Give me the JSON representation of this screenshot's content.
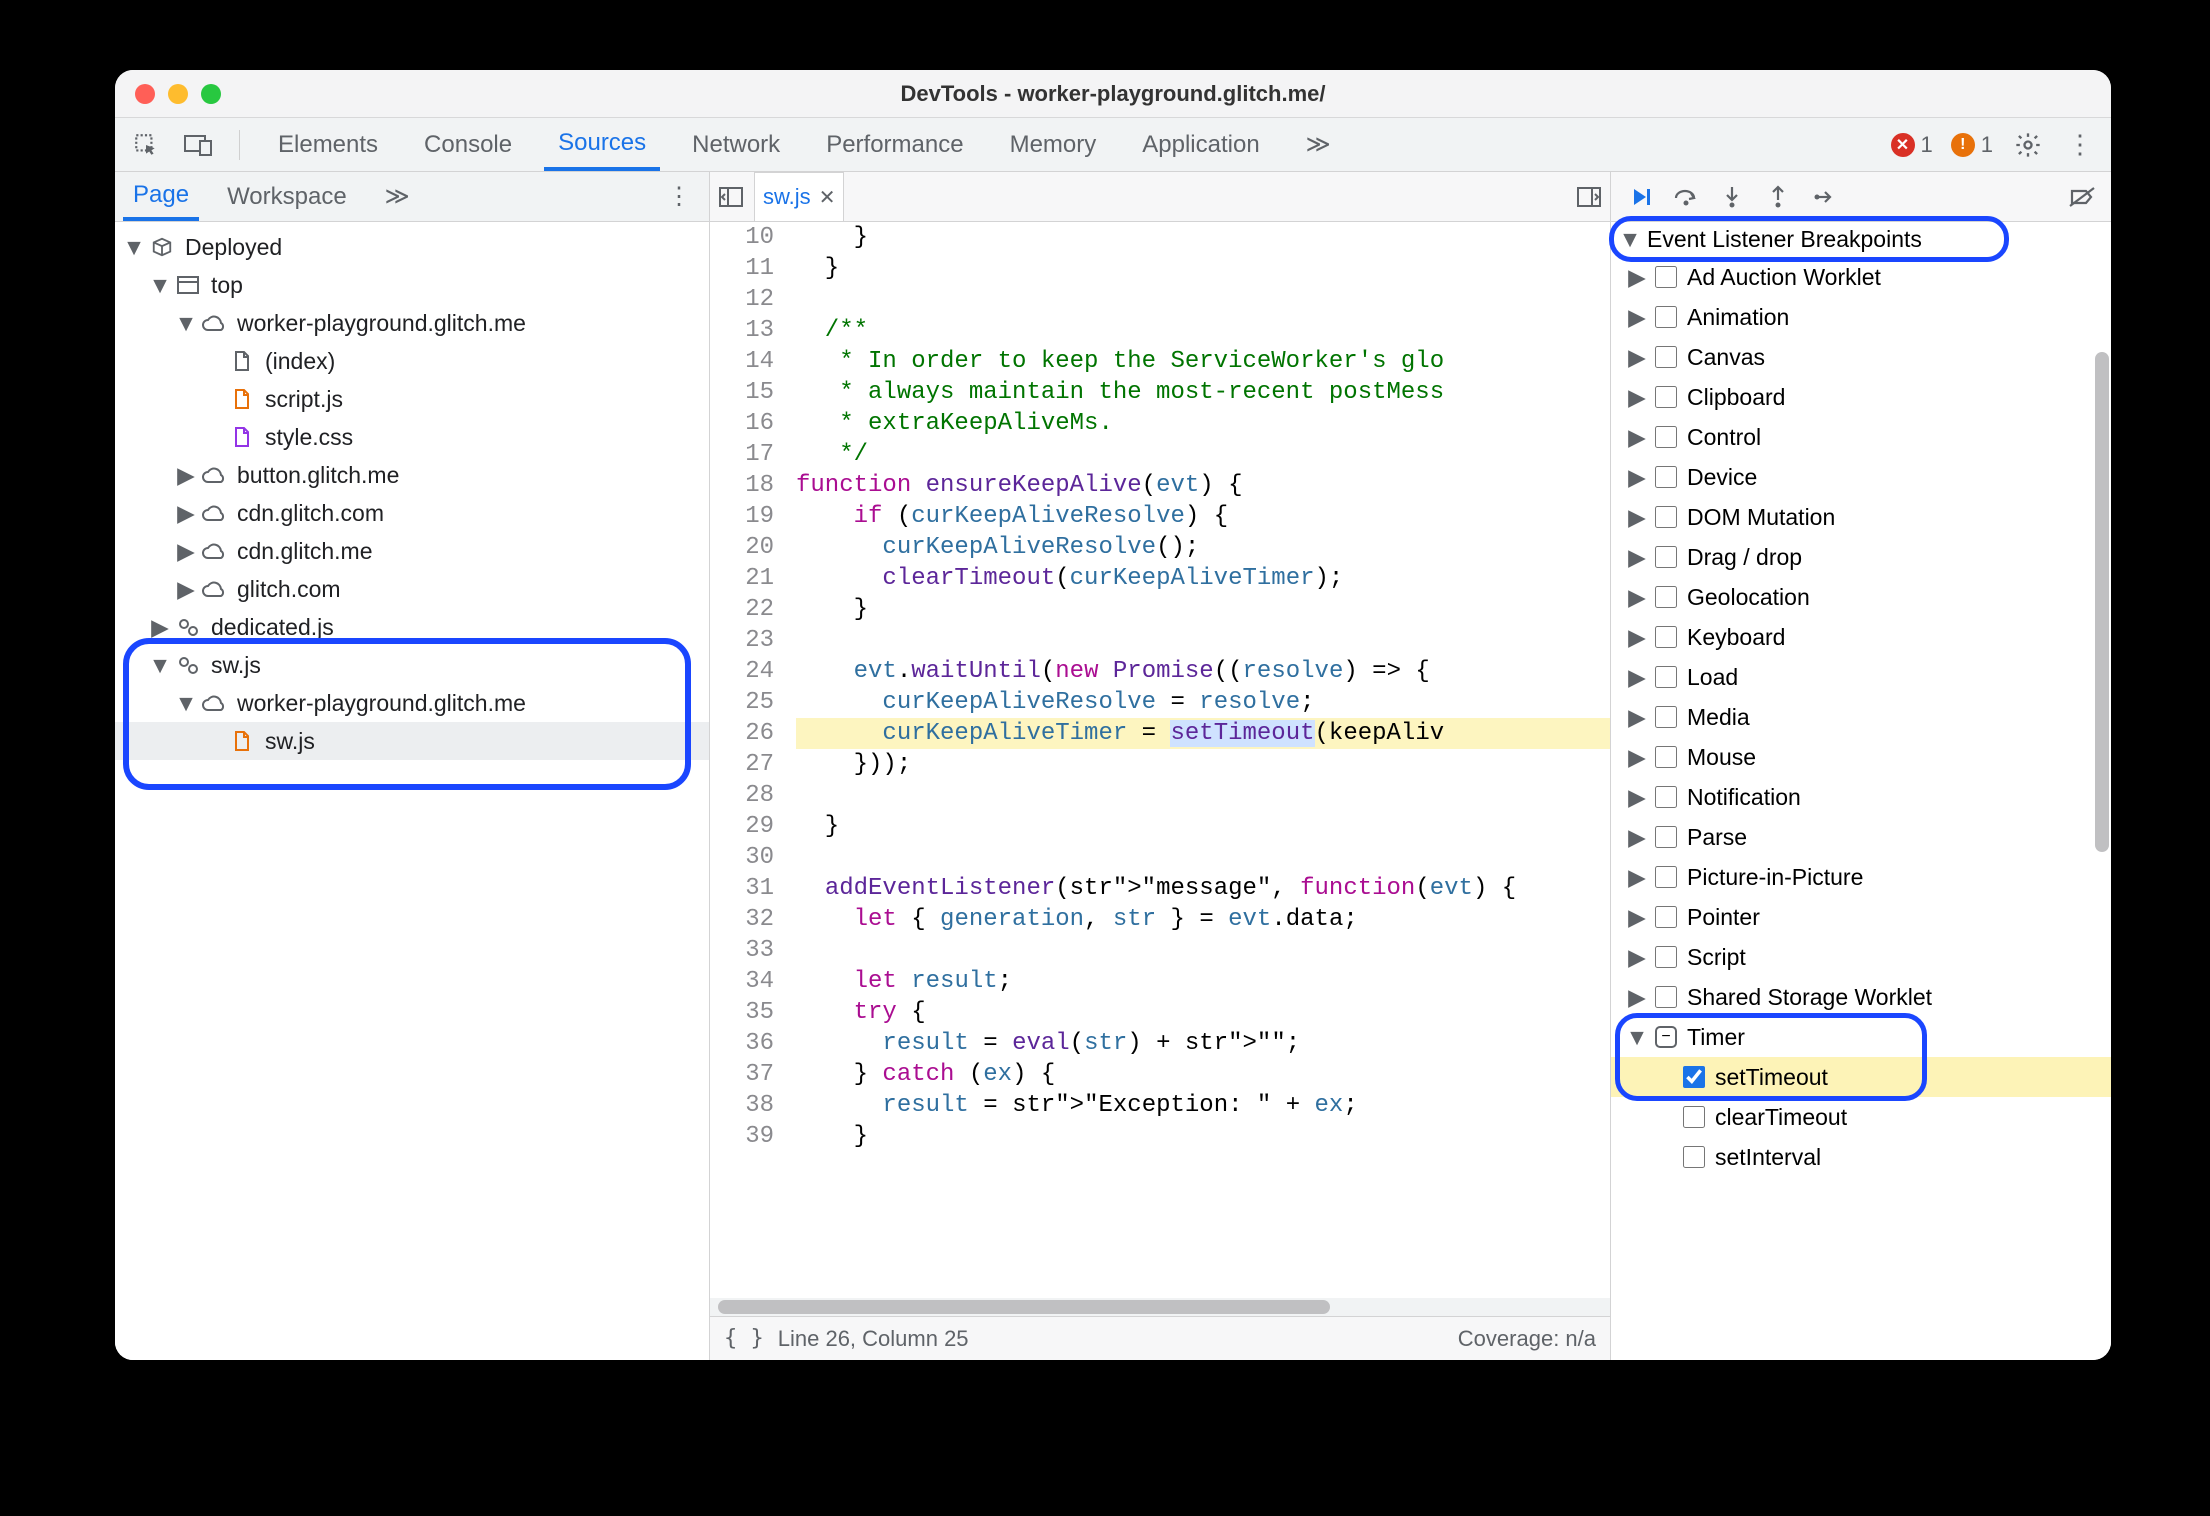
{
  "window_title": "DevTools - worker-playground.glitch.me/",
  "toolbar": {
    "tabs": [
      "Elements",
      "Console",
      "Sources",
      "Network",
      "Performance",
      "Memory",
      "Application"
    ],
    "active": 2,
    "more": "≫",
    "errors": {
      "red_count": "1",
      "orange_count": "1"
    }
  },
  "left_tabs": {
    "items": [
      "Page",
      "Workspace"
    ],
    "active": 0,
    "more": "≫"
  },
  "tree": {
    "r0": "Deployed",
    "r1": "top",
    "r2": "worker-playground.glitch.me",
    "r3": "(index)",
    "r4": "script.js",
    "r5": "style.css",
    "r6": "button.glitch.me",
    "r7": "cdn.glitch.com",
    "r8": "cdn.glitch.me",
    "r9": "glitch.com",
    "r10": "dedicated.js",
    "r11": "sw.js",
    "r12": "worker-playground.glitch.me",
    "r13": "sw.js"
  },
  "editor": {
    "file": "sw.js",
    "status": "Line 26, Column 25",
    "coverage": "Coverage: n/a",
    "lines": [
      [
        10,
        "    }"
      ],
      [
        11,
        "  }"
      ],
      [
        12,
        ""
      ],
      [
        13,
        "  /**"
      ],
      [
        14,
        "   * In order to keep the ServiceWorker's glo"
      ],
      [
        15,
        "   * always maintain the most-recent postMess"
      ],
      [
        16,
        "   * extraKeepAliveMs."
      ],
      [
        17,
        "   */"
      ],
      [
        18,
        "function ensureKeepAlive(evt) {"
      ],
      [
        19,
        "    if (curKeepAliveResolve) {"
      ],
      [
        20,
        "      curKeepAliveResolve();"
      ],
      [
        21,
        "      clearTimeout(curKeepAliveTimer);"
      ],
      [
        22,
        "    }"
      ],
      [
        23,
        ""
      ],
      [
        24,
        "    evt.waitUntil(new Promise((resolve) => {"
      ],
      [
        25,
        "      curKeepAliveResolve = resolve;"
      ],
      [
        26,
        "      curKeepAliveTimer = setTimeout(keepAliv"
      ],
      [
        27,
        "    }));"
      ],
      [
        28,
        ""
      ],
      [
        29,
        "  }"
      ],
      [
        30,
        ""
      ],
      [
        31,
        "  addEventListener(\"message\", function(evt) {"
      ],
      [
        32,
        "    let { generation, str } = evt.data;"
      ],
      [
        33,
        ""
      ],
      [
        34,
        "    let result;"
      ],
      [
        35,
        "    try {"
      ],
      [
        36,
        "      result = eval(str) + \"\";"
      ],
      [
        37,
        "    } catch (ex) {"
      ],
      [
        38,
        "      result = \"Exception: \" + ex;"
      ],
      [
        39,
        "    }"
      ]
    ]
  },
  "breakpoints_header": "Event Listener Breakpoints",
  "bp_groups": [
    "Ad Auction Worklet",
    "Animation",
    "Canvas",
    "Clipboard",
    "Control",
    "Device",
    "DOM Mutation",
    "Drag / drop",
    "Geolocation",
    "Keyboard",
    "Load",
    "Media",
    "Mouse",
    "Notification",
    "Parse",
    "Picture-in-Picture",
    "Pointer",
    "Script",
    "Shared Storage Worklet"
  ],
  "timer_group": {
    "label": "Timer",
    "items": [
      "setTimeout",
      "clearTimeout",
      "setInterval"
    ],
    "checked_index": 0
  }
}
